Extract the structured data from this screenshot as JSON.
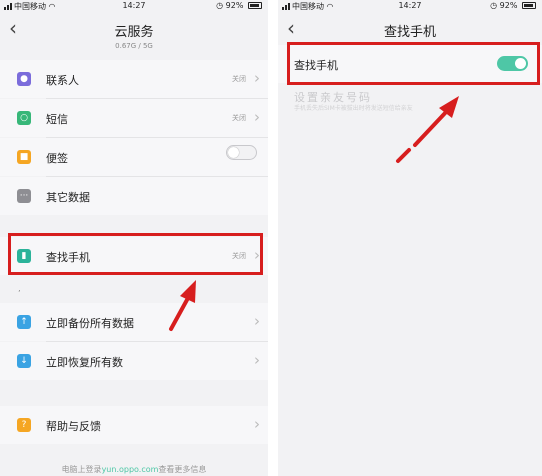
{
  "left_screen": {
    "status_bar": {
      "carrier": "中国移动",
      "time": "14:27",
      "battery": "92%"
    },
    "title": "云服务",
    "storage": "0.67G / 5G",
    "items": [
      {
        "label": "联系人",
        "status": "关闭",
        "icon": "contacts-icon",
        "color": "#7b6cdb"
      },
      {
        "label": "短信",
        "status": "关闭",
        "icon": "message-icon",
        "color": "#37b779"
      },
      {
        "label": "便签",
        "icon": "note-icon",
        "color": "#f5a623",
        "toggle": "off"
      },
      {
        "label": "其它数据",
        "icon": "more-data-icon",
        "color": "#8e8e93"
      },
      {
        "label": "查找手机",
        "status": "关闭",
        "icon": "find-phone-icon",
        "color": "#2bb39a"
      },
      {
        "label": "立即备份所有数据",
        "icon": "backup-icon",
        "color": "#3aa3e3"
      },
      {
        "label": "立即恢复所有数",
        "icon": "restore-icon",
        "color": "#3aa3e3"
      },
      {
        "label": "帮助与反馈",
        "icon": "help-icon",
        "color": "#f5a623"
      }
    ],
    "footer_prefix": "电脑上登录",
    "footer_link": "yun.oppo.com",
    "footer_suffix": "查看更多信息"
  },
  "right_screen": {
    "status_bar": {
      "carrier": "中国移动",
      "time": "14:27",
      "battery": "92%"
    },
    "title": "查找手机",
    "find_phone_label": "查找手机",
    "find_phone_toggle": "on",
    "secondary_title": "设置亲友号码",
    "secondary_desc": "手机丢失后SIM卡被拔出时将发送短信给亲友"
  },
  "colors": {
    "highlight_red": "#d71e1e",
    "toggle_on": "#4ec7a6",
    "link": "#4ec7a6"
  }
}
